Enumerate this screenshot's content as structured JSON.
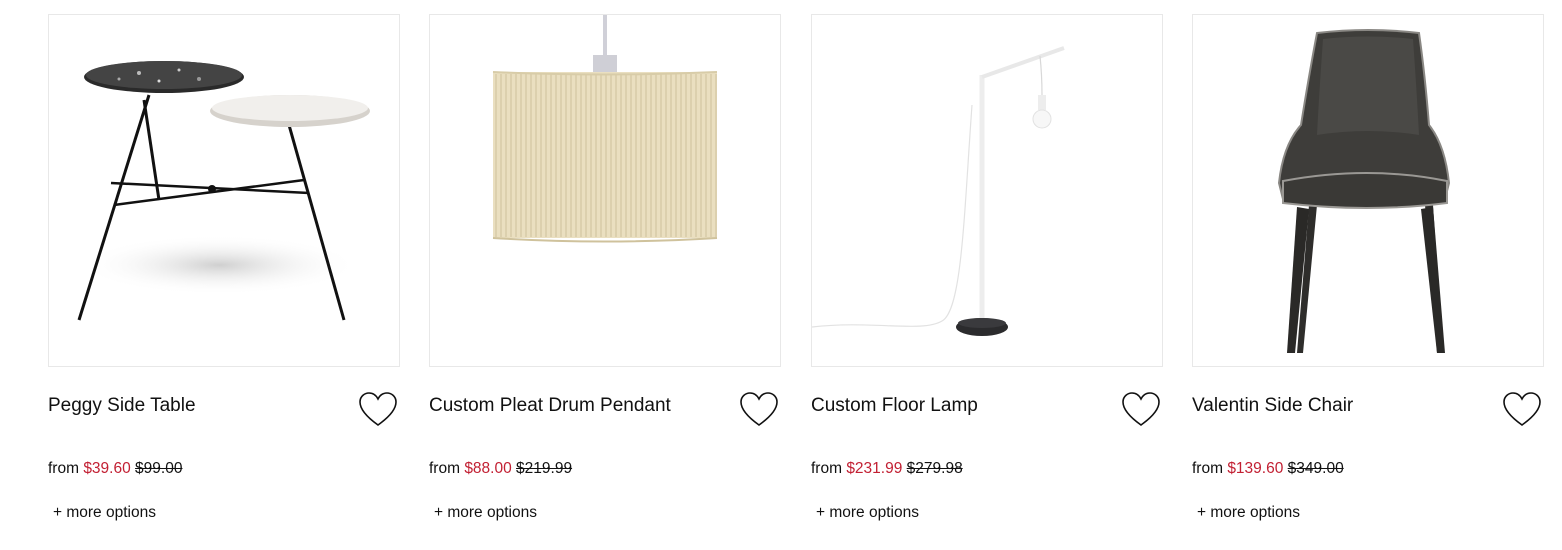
{
  "products": [
    {
      "name": "Peggy Side Table",
      "price_prefix": "from",
      "sale_price": "$39.60",
      "original_price": "$99.00",
      "more_options": "+ more options",
      "image": "side-table-image"
    },
    {
      "name": "Custom Pleat Drum Pendant",
      "price_prefix": "from",
      "sale_price": "$88.00",
      "original_price": "$219.99",
      "more_options": "+ more options",
      "image": "pendant-lamp-image"
    },
    {
      "name": "Custom Floor Lamp",
      "price_prefix": "from",
      "sale_price": "$231.99",
      "original_price": "$279.98",
      "more_options": "+ more options",
      "image": "floor-lamp-image"
    },
    {
      "name": "Valentin Side Chair",
      "price_prefix": "from",
      "sale_price": "$139.60",
      "original_price": "$349.00",
      "more_options": "+ more options",
      "image": "side-chair-image"
    }
  ],
  "colors": {
    "sale": "#c22033",
    "text": "#111111",
    "border": "#e8e8e8"
  },
  "icons": {
    "favorite": "heart-icon"
  }
}
